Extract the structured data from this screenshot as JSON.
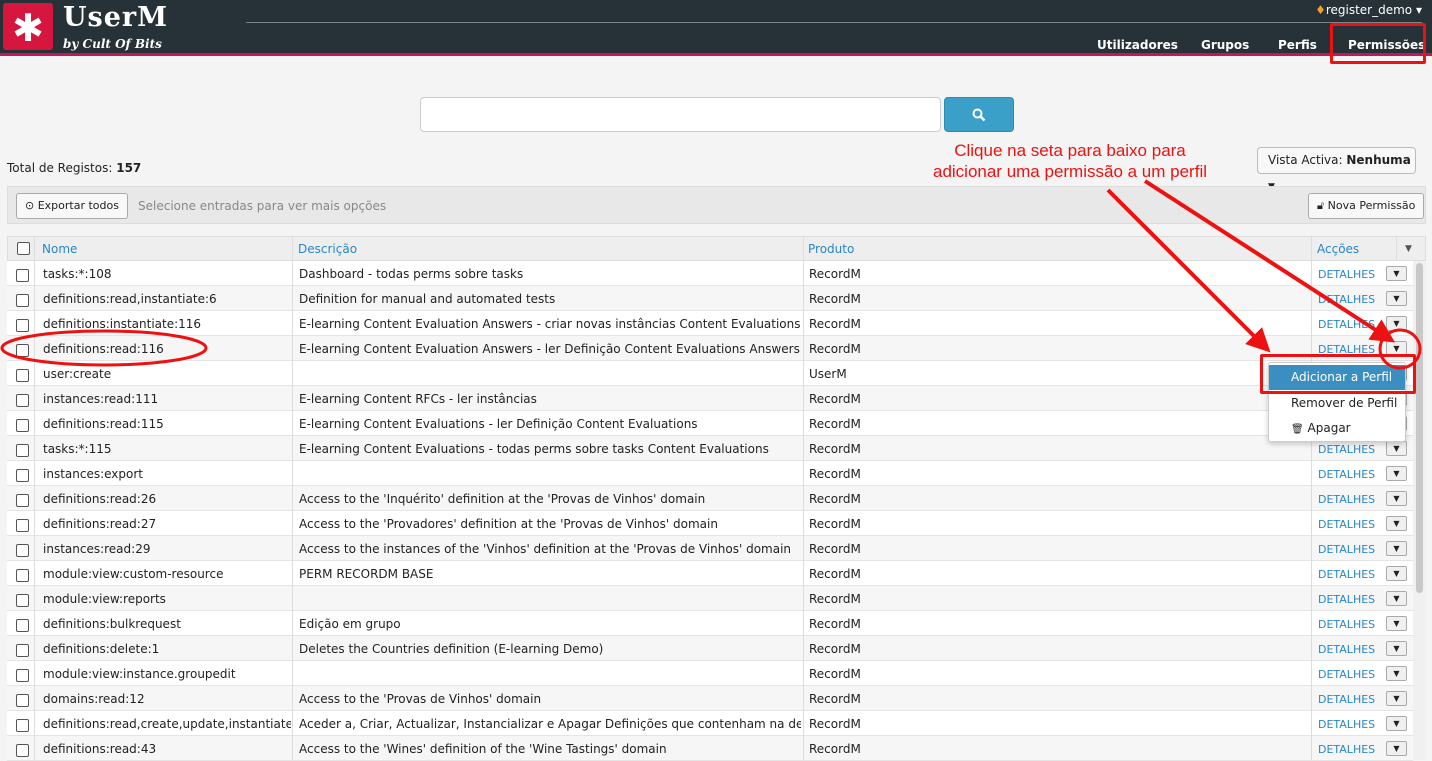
{
  "app": {
    "logo_glyph": "✱",
    "name": "UserM",
    "subtitle": "by Cult Of Bits"
  },
  "user": {
    "name": "register_demo"
  },
  "nav": [
    "Utilizadores",
    "Grupos",
    "Perfis",
    "Permissões"
  ],
  "search": {
    "placeholder": "",
    "button_icon": "search-icon"
  },
  "total": {
    "label": "Total de Registos:",
    "count": "157"
  },
  "annotation": {
    "line1": "Clique na seta para baixo para",
    "line2": "adicionar uma permissão a um perfil"
  },
  "view": {
    "label": "Vista Activa:",
    "value": "Nenhuma"
  },
  "toolbar": {
    "export_label": "Exportar todos",
    "hint": "Selecione entradas para ver mais opções",
    "new_label": "Nova Permissão"
  },
  "columns": {
    "name": "Nome",
    "description": "Descrição",
    "product": "Produto",
    "actions": "Acções"
  },
  "details_label": "DETALHES",
  "rows": [
    {
      "name": "tasks:*:108",
      "description": "Dashboard - todas perms sobre tasks",
      "product": "RecordM"
    },
    {
      "name": "definitions:read,instantiate:6",
      "description": "Definition for manual and automated tests",
      "product": "RecordM"
    },
    {
      "name": "definitions:instantiate:116",
      "description": "E-learning Content Evaluation Answers - criar novas instâncias Content Evaluations Answers",
      "product": "RecordM"
    },
    {
      "name": "definitions:read:116",
      "description": "E-learning Content Evaluation Answers - ler Definição Content Evaluations Answers",
      "product": "RecordM"
    },
    {
      "name": "user:create",
      "description": "",
      "product": "UserM"
    },
    {
      "name": "instances:read:111",
      "description": "E-learning Content RFCs - ler instâncias",
      "product": "RecordM"
    },
    {
      "name": "definitions:read:115",
      "description": "E-learning Content Evaluations - ler Definição Content Evaluations",
      "product": "RecordM"
    },
    {
      "name": "tasks:*:115",
      "description": "E-learning Content Evaluations - todas perms sobre tasks Content Evaluations",
      "product": "RecordM"
    },
    {
      "name": "instances:export",
      "description": "",
      "product": "RecordM"
    },
    {
      "name": "definitions:read:26",
      "description": "Access to the 'Inquérito' definition at the 'Provas de Vinhos' domain",
      "product": "RecordM"
    },
    {
      "name": "definitions:read:27",
      "description": "Access to the 'Provadores' definition at the 'Provas de Vinhos' domain",
      "product": "RecordM"
    },
    {
      "name": "instances:read:29",
      "description": "Access to the instances of the 'Vinhos' definition at the 'Provas de Vinhos' domain",
      "product": "RecordM"
    },
    {
      "name": "module:view:custom-resource",
      "description": "PERM RECORDM BASE",
      "product": "RecordM"
    },
    {
      "name": "module:view:reports",
      "description": "",
      "product": "RecordM"
    },
    {
      "name": "definitions:bulkrequest",
      "description": "Edição em grupo",
      "product": "RecordM"
    },
    {
      "name": "definitions:delete:1",
      "description": "Deletes the Countries definition (E-learning Demo)",
      "product": "RecordM"
    },
    {
      "name": "module:view:instance.groupedit",
      "description": "",
      "product": "RecordM"
    },
    {
      "name": "domains:read:12",
      "description": "Access to the 'Provas de Vinhos' domain",
      "product": "RecordM"
    },
    {
      "name": "definitions:read,create,update,instantiate,...",
      "description": "Aceder a, Criar, Actualizar, Instancializar e Apagar Definições que contenham na descrição...",
      "product": "RecordM"
    },
    {
      "name": "definitions:read:43",
      "description": "Access to the 'Wines' definition of the 'Wine Tastings' domain",
      "product": "RecordM"
    }
  ],
  "dropdown": {
    "add": "Adicionar a Perfil",
    "remove": "Remover de Perfil",
    "delete": "Apagar"
  },
  "colors": {
    "topbar": "#263238",
    "accent": "#d6163f",
    "link": "#2a86c8",
    "annotation": "#ee1111"
  }
}
